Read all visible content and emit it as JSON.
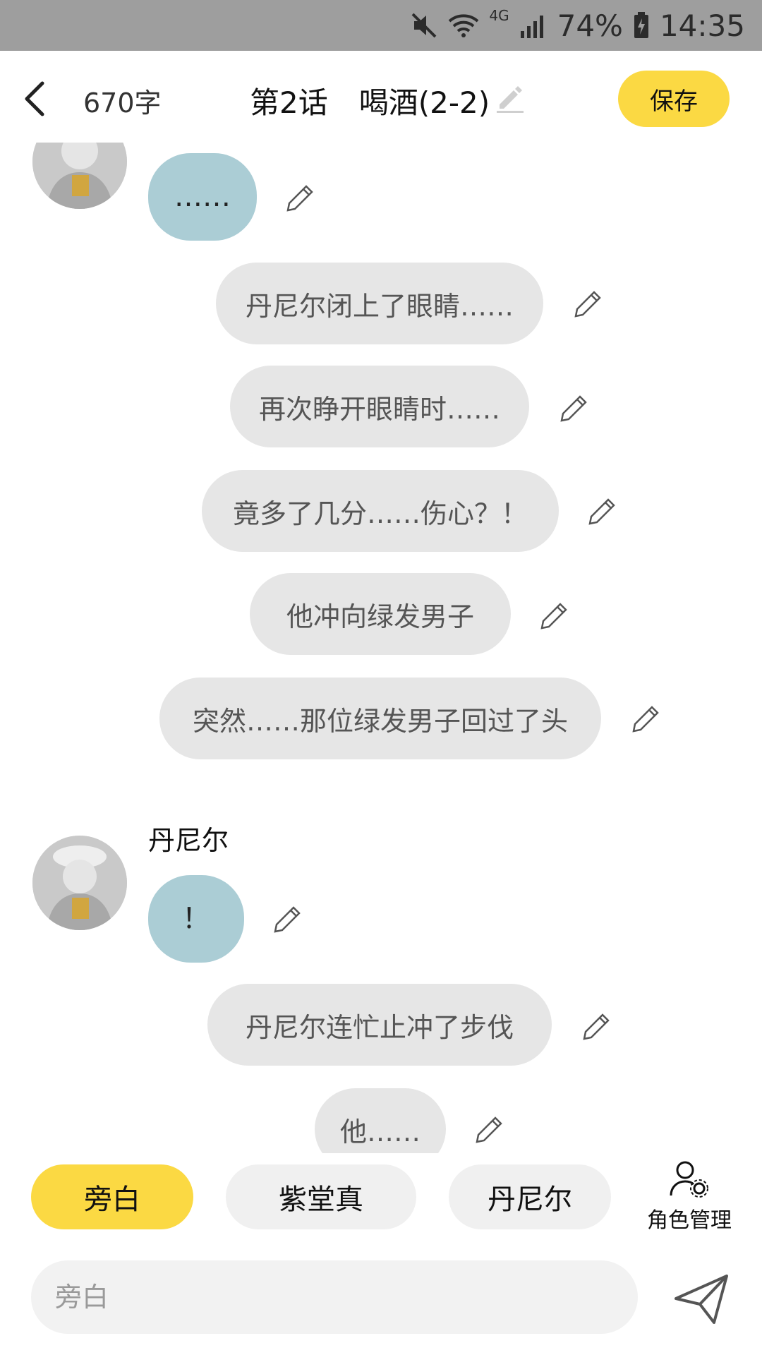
{
  "status_bar": {
    "network": "4G",
    "battery": "74%",
    "time": "14:35"
  },
  "header": {
    "word_count": "670字",
    "episode": "第2话",
    "chapter_title": "喝酒(2-2)",
    "save_label": "保存"
  },
  "messages": [
    {
      "type": "character",
      "text": "……"
    },
    {
      "type": "narration",
      "text": "丹尼尔闭上了眼睛……"
    },
    {
      "type": "narration",
      "text": "再次睁开眼睛时……"
    },
    {
      "type": "narration",
      "text": "竟多了几分……伤心？！"
    },
    {
      "type": "narration",
      "text": "他冲向绿发男子"
    },
    {
      "type": "narration",
      "text": "突然……那位绿发男子回过了头"
    },
    {
      "type": "character",
      "name": "丹尼尔",
      "text": "！"
    },
    {
      "type": "narration",
      "text": "丹尼尔连忙止冲了步伐"
    },
    {
      "type": "narration",
      "text": "他……"
    }
  ],
  "characters": {
    "chips": [
      "旁白",
      "紫堂真",
      "丹尼尔"
    ],
    "active": "旁白",
    "manage_label": "角色管理"
  },
  "input": {
    "placeholder": "旁白"
  },
  "colors": {
    "accent": "#fbd943",
    "character_bubble": "#abcdd5",
    "narration_bubble": "#e6e6e6"
  }
}
